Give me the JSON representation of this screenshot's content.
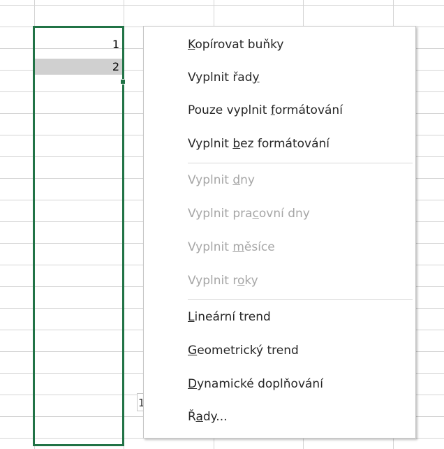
{
  "cells": {
    "a1": "1",
    "a2": "2"
  },
  "autofill_options_tag": "1",
  "colors": {
    "selection_border": "#217346",
    "gridline": "#d4d4d4",
    "selected_cell_fill": "#d0d0d0",
    "menu_text": "#262626",
    "menu_text_disabled": "#a6a6a6"
  },
  "context_menu": {
    "items": [
      {
        "pre": "",
        "key": "K",
        "post": "opírovat buňky",
        "enabled": true
      },
      {
        "pre": "Vyplnit řad",
        "key": "y",
        "post": "",
        "enabled": true
      },
      {
        "pre": "Pouze vyplnit ",
        "key": "f",
        "post": "ormátování",
        "enabled": true
      },
      {
        "pre": "Vyplnit ",
        "key": "b",
        "post": "ez formátování",
        "enabled": true
      },
      {
        "pre": "Vyplnit ",
        "key": "d",
        "post": "ny",
        "enabled": false
      },
      {
        "pre": "Vyplnit pra",
        "key": "c",
        "post": "ovní dny",
        "enabled": false
      },
      {
        "pre": "Vyplnit ",
        "key": "m",
        "post": "ěsíce",
        "enabled": false
      },
      {
        "pre": "Vyplnit r",
        "key": "o",
        "post": "ky",
        "enabled": false
      },
      {
        "pre": "",
        "key": "L",
        "post": "ineární trend",
        "enabled": true
      },
      {
        "pre": "",
        "key": "G",
        "post": "eometrický trend",
        "enabled": true
      },
      {
        "pre": "",
        "key": "D",
        "post": "ynamické doplňování",
        "enabled": true
      },
      {
        "pre": "Ř",
        "key": "a",
        "post": "dy...",
        "enabled": true
      }
    ]
  }
}
